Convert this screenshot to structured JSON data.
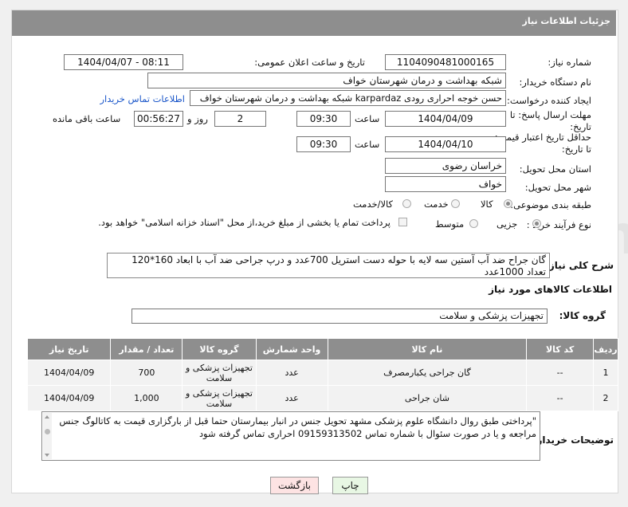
{
  "header": {
    "title": "جزئیات اطلاعات نیاز"
  },
  "form": {
    "need_number": {
      "label": "شماره نیاز:",
      "value": "1104090481000165"
    },
    "announce_datetime": {
      "label": "تاریخ و ساعت اعلان عمومی:",
      "value": "1404/04/07 - 08:11"
    },
    "buyer_org": {
      "label": "نام دستگاه خریدار:",
      "value": "شبکه بهداشت و درمان شهرستان خواف"
    },
    "requester": {
      "label": "ایجاد کننده درخواست:",
      "value": "حسن خوجه احراری رودی karpardaz شبکه بهداشت و درمان شهرستان خواف",
      "contact_link": "اطلاعات تماس خریدار"
    },
    "reply_deadline": {
      "label": "مهلت ارسال پاسخ: تا تاریخ:",
      "date": "1404/04/09",
      "time_label": "ساعت",
      "time": "09:30",
      "days": "2",
      "days_label": "روز و",
      "remaining": "00:56:27",
      "remaining_label": "ساعت باقی مانده"
    },
    "price_validity": {
      "label": "حداقل تاریخ اعتبار قیمت: تا تاریخ:",
      "date": "1404/04/10",
      "time_label": "ساعت",
      "time": "09:30"
    },
    "delivery_province": {
      "label": "استان محل تحویل:",
      "value": "خراسان رضوی"
    },
    "delivery_city": {
      "label": "شهر محل تحویل:",
      "value": "خواف"
    },
    "category": {
      "label": "طبقه بندی موضوعی:",
      "options": [
        "کالا",
        "خدمت",
        "کالا/خدمت"
      ],
      "selected": "کالا"
    },
    "purchase_process": {
      "label": "نوع فرآیند خرید :",
      "options": [
        "جزیی",
        "متوسط"
      ],
      "note": "پرداخت تمام یا بخشی از مبلغ خرید،از محل \"اسناد خزانه اسلامی\" خواهد بود."
    },
    "general_desc": {
      "label": "شرح کلی نیاز:",
      "value": "گان جراح ضد آب آستین سه لایه با حوله دست استریل 700عدد و درپ جراحی ضد آب با ابعاد 160*120 تعداد 1000عدد"
    }
  },
  "goods": {
    "section_title": "اطلاعات کالاهای مورد نیاز",
    "group_label": "گروه کالا:",
    "group_value": "تجهیزات پزشکی و سلامت",
    "columns": [
      "ردیف",
      "کد کالا",
      "نام کالا",
      "واحد شمارش",
      "گروه کالا",
      "تعداد / مقدار",
      "تاریخ نیاز"
    ],
    "rows": [
      {
        "row": "1",
        "code": "--",
        "name": "گان جراحی یکبارمصرف",
        "unit": "عدد",
        "group": "تجهیزات پزشکی و سلامت",
        "qty": "700",
        "date": "1404/04/09"
      },
      {
        "row": "2",
        "code": "--",
        "name": "شان جراحی",
        "unit": "عدد",
        "group": "تجهیزات پزشکی و سلامت",
        "qty": "1,000",
        "date": "1404/04/09"
      }
    ]
  },
  "buyer_notes": {
    "label": "توضیحات خریدار:",
    "value": "\"پرداختی طبق روال دانشگاه علوم پزشکی مشهد تحویل جنس در انبار بیمارستان  حتما قبل از بارگزاری قیمت به کاتالوگ جنس مراجعه و یا در صورت سئوال با  شماره تماس 09159313502 احراری تماس گرفته شود"
  },
  "buttons": {
    "print": "چاپ",
    "back": "بازگشت"
  },
  "colors": {
    "header_bg": "#8e8e8e",
    "print_bg": "#e8f7e4",
    "back_bg": "#fde3e3",
    "link": "#1a56c9"
  }
}
